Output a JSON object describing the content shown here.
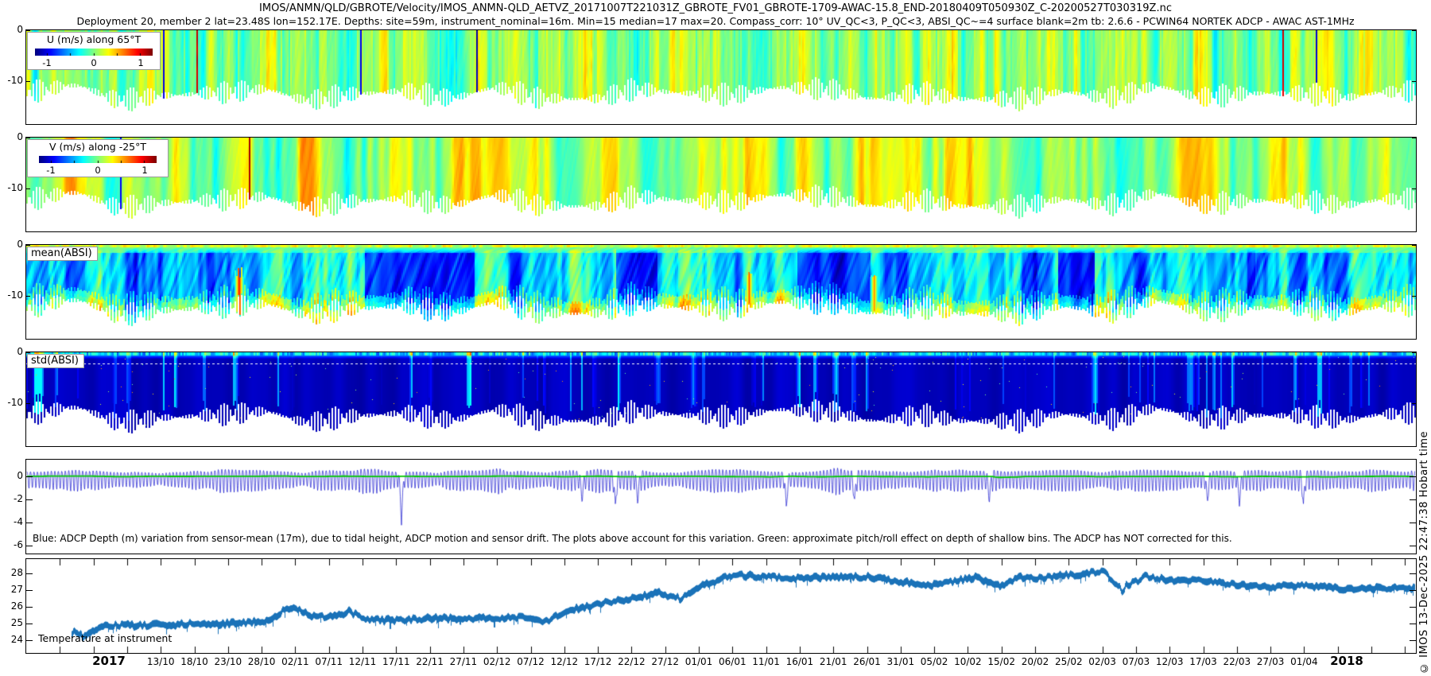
{
  "header": {
    "title": "IMOS/ANMN/QLD/GBROTE/Velocity/IMOS_ANMN-QLD_AETVZ_20171007T221031Z_GBROTE_FV01_GBROTE-1709-AWAC-15.8_END-20180409T050930Z_C-20200527T030319Z.nc",
    "subtitle": "Deployment 20, member 2 lat=23.48S lon=152.17E. Depths: site=59m, instrument_nominal=16m. Min=15 median=17 max=20. Compass_corr: 10° UV_QC<3, P_QC<3, ABSI_QC~=4 surface blank=2m tb: 2.6.6 - PCWIN64 NORTEK ADCP - AWAC AST-1MHz"
  },
  "watermark": "© IMOS 13-Dec-2025 22:47:38 Hobart time",
  "x_axis": {
    "year_start": "2017",
    "year_end": "2018",
    "date_ticks": [
      "13/10",
      "18/10",
      "23/10",
      "28/10",
      "02/11",
      "07/11",
      "12/11",
      "17/11",
      "22/11",
      "27/11",
      "02/12",
      "07/12",
      "12/12",
      "17/12",
      "22/12",
      "27/12",
      "01/01",
      "06/01",
      "11/01",
      "16/01",
      "21/01",
      "26/01",
      "31/01",
      "05/02",
      "10/02",
      "15/02",
      "20/02",
      "25/02",
      "02/03",
      "07/03",
      "12/03",
      "17/03",
      "22/03",
      "27/03",
      "01/04"
    ]
  },
  "panels": [
    {
      "key": "u",
      "legend_title": "U (m/s) along 65°T",
      "colorbar_ticks": [
        "-1",
        "0",
        "1"
      ],
      "y_ticks": [
        "0",
        "-10"
      ]
    },
    {
      "key": "v",
      "legend_title": "V (m/s) along -25°T",
      "colorbar_ticks": [
        "-1",
        "0",
        "1"
      ],
      "y_ticks": [
        "0",
        "-10"
      ]
    },
    {
      "key": "mean_absi",
      "box_label": "mean(ABSI)",
      "y_ticks": [
        "0",
        "-10"
      ]
    },
    {
      "key": "std_absi",
      "box_label": "std(ABSI)",
      "y_ticks": [
        "0",
        "-10"
      ]
    },
    {
      "key": "depth_variation",
      "y_ticks": [
        "0",
        "-2",
        "-4",
        "-6"
      ],
      "annotation": "Blue: ADCP Depth (m) variation from sensor-mean (17m), due to tidal height, ADCP motion and sensor drift. The plots above account for this variation. Green: approximate pitch/roll effect on depth of shallow bins. The ADCP has NOT corrected for this."
    },
    {
      "key": "temperature",
      "inner_label": "Temperature at instrument",
      "y_ticks": [
        "28",
        "27",
        "26",
        "25",
        "24"
      ]
    }
  ],
  "chart_data": [
    {
      "type": "heatmap",
      "title": "U (m/s) along 65°T",
      "colormap": "jet",
      "vmin": -1.25,
      "vmax": 1.25,
      "colorbar_ticks": [
        -1,
        0,
        1
      ],
      "y_ticks_m": [
        0,
        -10
      ],
      "depth_range_m": [
        0,
        -16
      ],
      "time_range": [
        "07/10/2017",
        "09/04/2018"
      ],
      "summary": "Along-shelf velocity, mostly 0±0.3 m/s (green) with short cyan/yellow bursts and rare ±1 m/s columns; jagged white bottom follows tidal depth",
      "gen": {
        "base": 0.05,
        "band_amp": 0.3,
        "band_days": 1.3,
        "hf_amp": 0.17,
        "hf_days": 0.3,
        "extreme_prob": 0.007
      }
    },
    {
      "type": "heatmap",
      "title": "V (m/s) along -25°T",
      "colormap": "jet",
      "vmin": -1.25,
      "vmax": 1.25,
      "colorbar_ticks": [
        -1,
        0,
        1
      ],
      "y_ticks_m": [
        0,
        -10
      ],
      "depth_range_m": [
        0,
        -16
      ],
      "summary": "Cross-shelf velocity with multi-day green / yellow-orange bands",
      "gen": {
        "base": 0.12,
        "band_amp": 0.4,
        "band_days": 3.2,
        "hf_amp": 0.2,
        "hf_days": 0.85,
        "extreme_prob": 0.004
      }
    },
    {
      "type": "heatmap",
      "title": "mean(ABSI)",
      "colormap": "jet",
      "y_ticks_m": [
        0,
        -10
      ],
      "summary": "Mean acoustic backscatter: blue/cyan interior with multi-day dark-blue episodes, green-yellow near surface and seabed, isolated orange-red spot near x≈0.15",
      "gen": {
        "base_t": 0.17,
        "slow_amp": 0.3,
        "slow_days": 2.2,
        "hotspots": [
          {
            "frac": 0.153,
            "t": 0.88
          },
          {
            "frac": 0.52,
            "t": 0.8
          },
          {
            "frac": 0.61,
            "t": 0.76
          }
        ]
      }
    },
    {
      "type": "heatmap",
      "title": "std(ABSI)",
      "colormap": "jet",
      "y_ticks_m": [
        0,
        -10
      ],
      "summary": "Backscatter standard deviation: dark navy with cyan speckle near the surface, sparse cyan vertical streaks, dotted white line near top",
      "gen": {
        "base_t": 0.035,
        "streak_days": 0.55,
        "streak_thresh": 0.8,
        "dotted_line_row": 14
      }
    },
    {
      "type": "line",
      "name": "ADCP depth variation",
      "units": "m",
      "ylim": [
        1.5,
        -6.7
      ],
      "y_ticks": [
        0,
        -2,
        -4,
        -6
      ],
      "annotation": "Blue: ADCP Depth (m) variation from sensor-mean (17m), due to tidal height, ADCP motion and sensor drift. The plots above account for this variation. Green: approximate pitch/roll effect on depth of shallow bins. The ADCP has NOT corrected for this.",
      "series": [
        {
          "name": "depth variation (blue)",
          "color": "#1414cd",
          "tidal_period_days": 0.5175,
          "amplitude_envelope_5day": [
            0.8,
            0.9,
            1.1,
            0.8,
            0.6,
            0.9,
            1.2,
            1.0,
            0.7,
            1.0,
            1.3,
            0.9,
            0.7,
            1.1,
            1.2,
            0.8,
            0.9,
            1.2,
            1.0,
            0.7,
            1.1,
            1.2,
            0.8,
            0.9,
            1.3,
            1.0,
            0.8,
            1.1,
            1.2,
            0.9,
            1.0,
            1.2,
            0.9,
            1.1,
            1.0
          ],
          "spikes": [
            {
              "frac": 0.27,
              "depth": -4.3
            },
            {
              "frac": 0.4,
              "depth": -2.3
            },
            {
              "frac": 0.424,
              "depth": -2.6
            },
            {
              "frac": 0.44,
              "depth": -2.4
            },
            {
              "frac": 0.547,
              "depth": -2.8
            },
            {
              "frac": 0.596,
              "depth": -2.2
            },
            {
              "frac": 0.693,
              "depth": -2.3
            },
            {
              "frac": 0.85,
              "depth": -2.3
            },
            {
              "frac": 0.873,
              "depth": -2.6
            },
            {
              "frac": 0.919,
              "depth": -2.5
            }
          ]
        },
        {
          "name": "pitch/roll effect (green)",
          "color": "#00c800",
          "value": 0
        }
      ]
    },
    {
      "type": "line",
      "name": "Temperature at instrument",
      "units": "degC",
      "ylim": [
        28.86,
        23.24
      ],
      "y_ticks": [
        28,
        27,
        26,
        25,
        24
      ],
      "color": "#1a72b8",
      "x_samples": "every 5 days from 13/10/2017 to 06/04/2018",
      "values_5day": [
        24.9,
        25.0,
        25.0,
        25.1,
        25.5,
        25.4,
        25.2,
        25.2,
        25.3,
        25.3,
        25.3,
        25.4,
        25.7,
        26.2,
        26.5,
        26.9,
        27.2,
        27.9,
        27.8,
        27.7,
        27.8,
        27.8,
        27.5,
        27.3,
        27.7,
        27.9,
        27.7,
        27.9,
        28.1,
        27.9,
        27.6,
        27.6,
        27.3,
        27.2,
        27.3,
        27.1
      ],
      "excursions": [
        {
          "frac": 0.04,
          "delta": -0.9
        },
        {
          "frac": 0.189,
          "delta": 0.75
        },
        {
          "frac": 0.232,
          "delta": 0.55
        },
        {
          "frac": 0.373,
          "delta": -0.5
        },
        {
          "frac": 0.47,
          "delta": -0.7
        },
        {
          "frac": 0.7,
          "delta": -0.9
        },
        {
          "frac": 0.79,
          "delta": -1.2
        }
      ]
    }
  ]
}
